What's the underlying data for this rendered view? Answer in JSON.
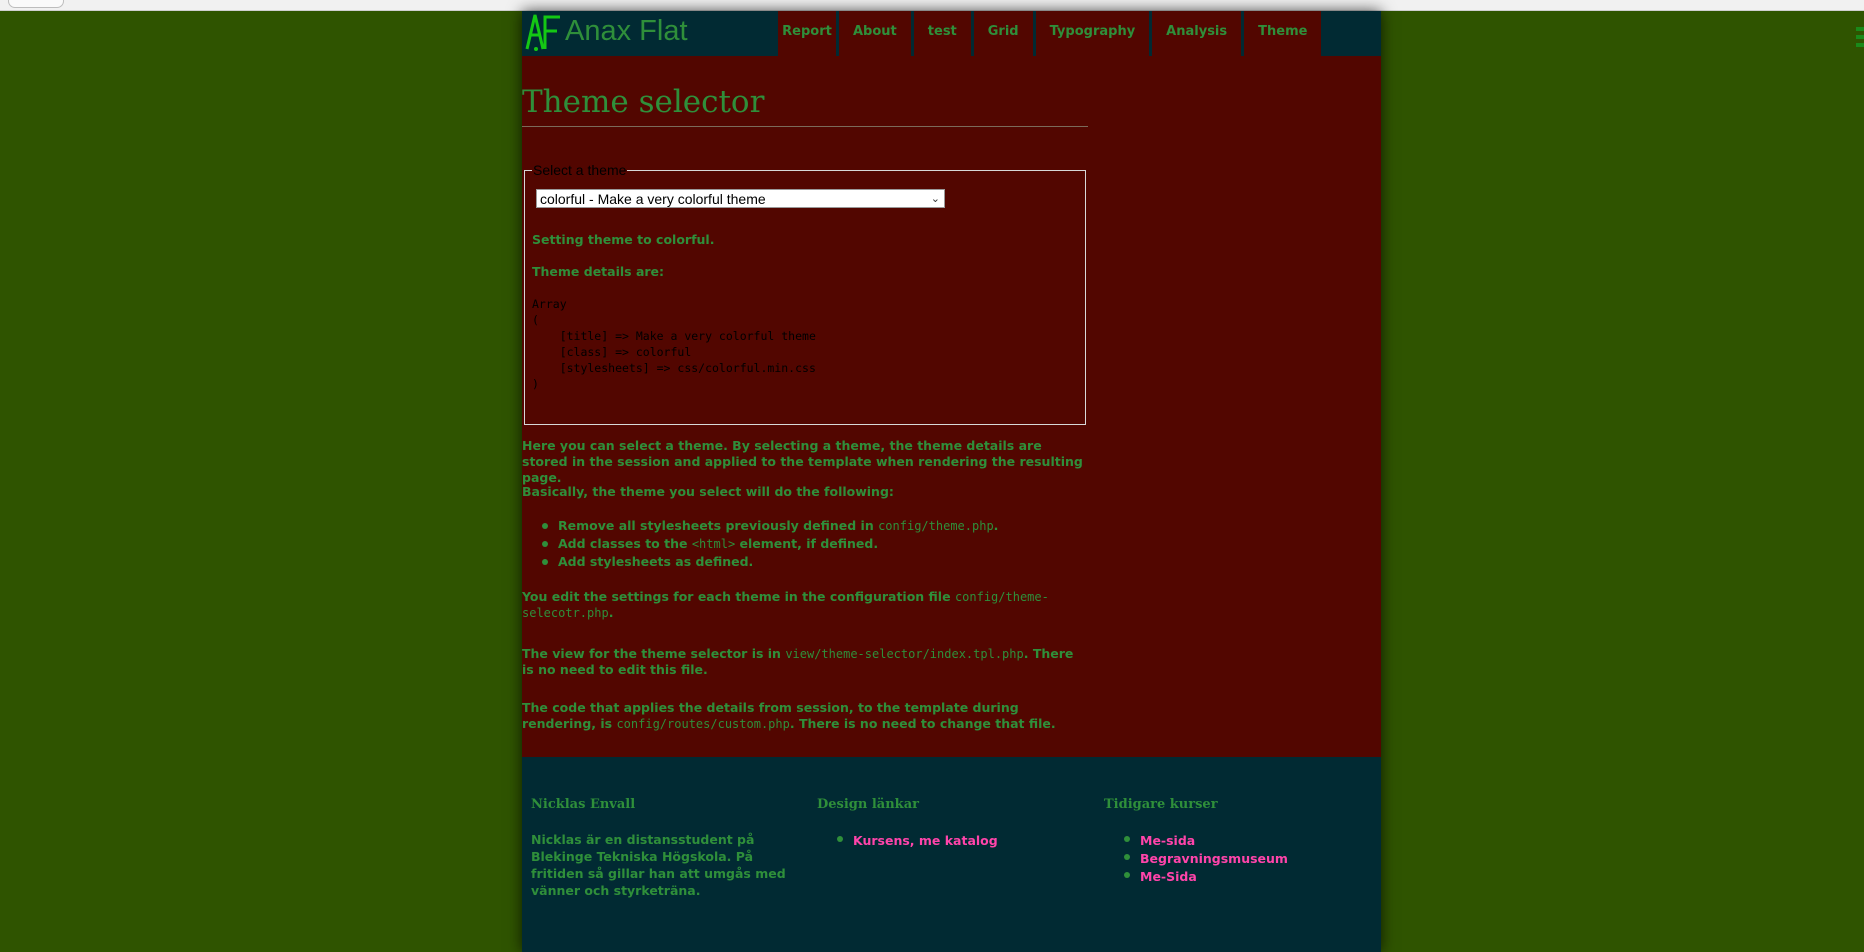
{
  "site": {
    "title": "Anax Flat",
    "logo_text": "AF"
  },
  "nav": {
    "items": [
      "Report",
      "About",
      "test",
      "Grid",
      "Typography",
      "Analysis",
      "Theme"
    ]
  },
  "page": {
    "title": "Theme selector",
    "fieldset_legend": "Select a theme",
    "select_value": "colorful - Make a very colorful theme",
    "setting_msg": "Setting theme to colorful.",
    "details_label": "Theme details are:",
    "array_dump": "Array\n(\n    [title] => Make a very colorful theme\n    [class] => colorful\n    [stylesheets] => css/colorful.min.css\n)",
    "intro": "Here you can select a theme. By selecting a theme, the theme details are stored in the session and applied to the template when rendering the resulting page.",
    "basically": "Basically, the theme you select will do the following:",
    "rules": [
      {
        "pre": "Remove all stylesheets previously defined in ",
        "code": "config/theme.php",
        "post": "."
      },
      {
        "pre": "Add classes to the ",
        "code": "<html>",
        "post": " element, if defined."
      },
      {
        "pre": "Add stylesheets as defined.",
        "code": "",
        "post": ""
      }
    ],
    "edit_pre": "You edit the settings for each theme in the configuration file ",
    "edit_code": "config/theme-selecotr.php",
    "edit_post": ".",
    "view_pre": "The view for the theme selector is in ",
    "view_code": "view/theme-selector/index.tpl.php",
    "view_post": ". There is no need to edit this file.",
    "code_pre": "The code that applies the details from session, to the template during rendering, is ",
    "code_code": "config/routes/custom.php",
    "code_post": ". There is no need to change that file."
  },
  "footer": {
    "col1": {
      "title": "Nicklas Envall",
      "text": "Nicklas är en distansstudent på Blekinge Tekniska Högskola. På fritiden så gillar han att umgås med vänner och styrketräna."
    },
    "col2": {
      "title": "Design länkar",
      "links": [
        "Kursens, me katalog"
      ]
    },
    "col3": {
      "title": "Tidigare kurser",
      "links": [
        "Me-sida",
        "Begravningsmuseum",
        "Me-Sida"
      ]
    }
  },
  "colors": {
    "page_bg": "#2f5400",
    "content_bg": "#520600",
    "header_bg": "#012a33",
    "text_green": "#2f8f3a",
    "link_pink": "#ff44aa"
  }
}
